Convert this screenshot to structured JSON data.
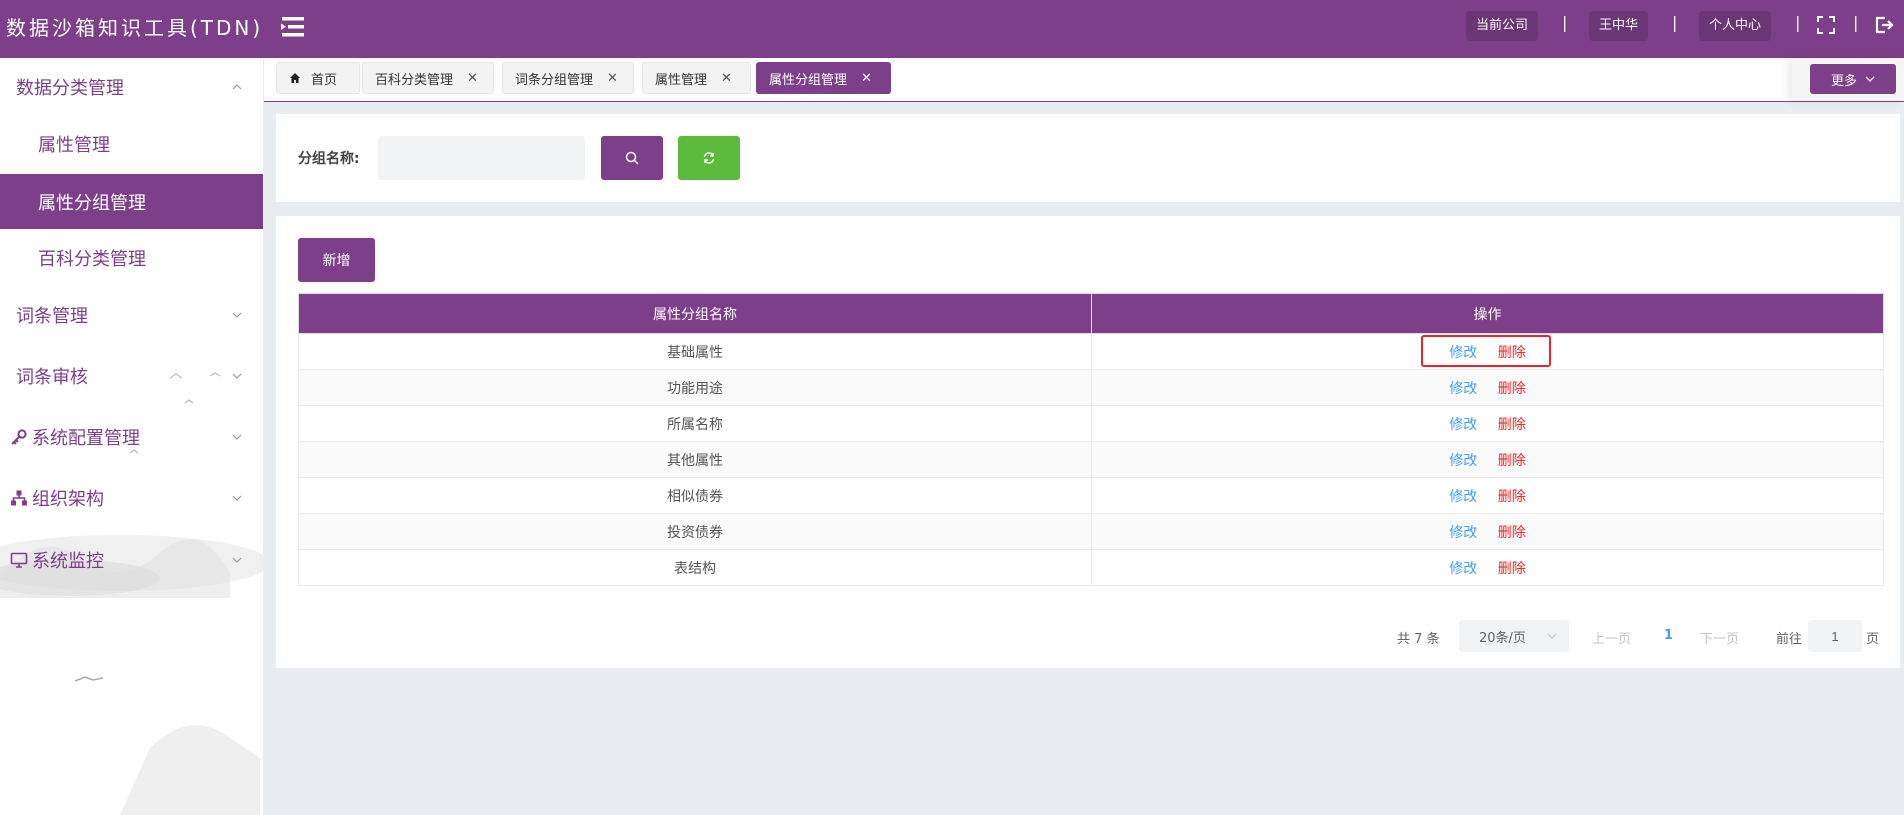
{
  "header": {
    "title": "数据沙箱知识工具(TDN)",
    "company": "当前公司",
    "user": "王中华",
    "profile": "个人中心",
    "separator": "|",
    "bg_color": "#7d3f8a"
  },
  "sidebar": {
    "groups": [
      {
        "label": "数据分类管理",
        "icon": "",
        "expanded": true
      },
      {
        "label": "词条管理",
        "icon": "",
        "expanded": false
      },
      {
        "label": "词条审核",
        "icon": "",
        "expanded": false
      },
      {
        "label": "系统配置管理",
        "icon": "key-icon",
        "expanded": false
      },
      {
        "label": "组织架构",
        "icon": "org-chart-icon",
        "expanded": false
      },
      {
        "label": "系统监控",
        "icon": "monitor-icon",
        "expanded": false
      }
    ],
    "sub_items": [
      {
        "label": "属性管理",
        "active": false
      },
      {
        "label": "属性分组管理",
        "active": true
      },
      {
        "label": "百科分类管理",
        "active": false
      }
    ]
  },
  "tabs": [
    {
      "label": "首页",
      "closable": false,
      "active": false
    },
    {
      "label": "百科分类管理",
      "closable": true,
      "active": false
    },
    {
      "label": "词条分组管理",
      "closable": true,
      "active": false
    },
    {
      "label": "属性管理",
      "closable": true,
      "active": false
    },
    {
      "label": "属性分组管理",
      "closable": true,
      "active": true
    }
  ],
  "tab_close_glyph": "✕",
  "more_label": "更多",
  "search": {
    "label": "分组名称:",
    "value": "",
    "placeholder": ""
  },
  "add_label": "新增",
  "table": {
    "columns": [
      "属性分组名称",
      "操作"
    ],
    "rows": [
      "基础属性",
      "功能用途",
      "所属名称",
      "其他属性",
      "相似债券",
      "投资债券",
      "表结构"
    ],
    "edit_label": "修改",
    "delete_label": "删除"
  },
  "pagination": {
    "total_text": "共 7 条",
    "page_size": "20条/页",
    "prev": "上一页",
    "current": "1",
    "next": "下一页",
    "goto_prefix": "前往",
    "goto_value": "1",
    "goto_suffix": "页"
  },
  "colors": {
    "primary": "#7d3f8a",
    "reset_button": "#5dbb3b",
    "edit_link": "#409eff",
    "delete_link": "#f02424",
    "highlight": "#e8232a"
  }
}
